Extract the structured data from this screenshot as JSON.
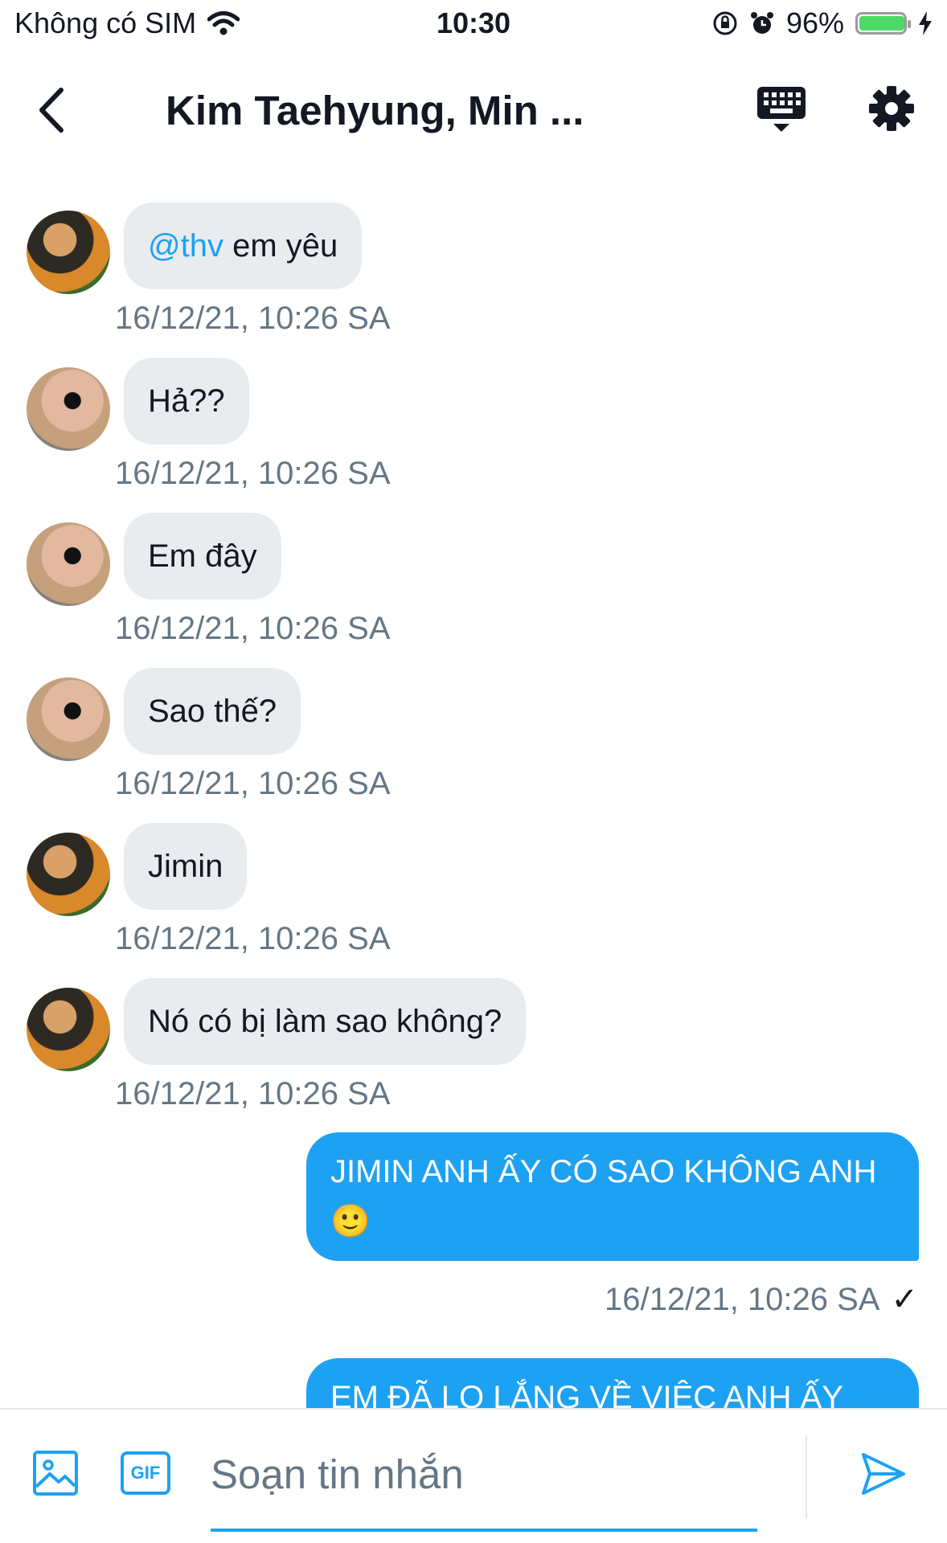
{
  "status_bar": {
    "carrier": "Không có SIM",
    "time": "10:30",
    "battery_percent": "96%",
    "battery_level": 0.96,
    "battery_color": "#4cd964"
  },
  "header": {
    "title": "Kim Taehyung, Min ...",
    "icons": [
      "chevron-left-icon",
      "keyboard-icon",
      "gear-icon"
    ]
  },
  "messages_in": [
    {
      "mention": "@thv",
      "text": " em yêu",
      "time": "16/12/21, 10:26 SA",
      "avatar": "avatar-1"
    },
    {
      "mention": "",
      "text": "Hả??",
      "time": "16/12/21, 10:26 SA",
      "avatar": "avatar-2"
    },
    {
      "mention": "",
      "text": "Em đây",
      "time": "16/12/21, 10:26 SA",
      "avatar": "avatar-2"
    },
    {
      "mention": "",
      "text": "Sao thế?",
      "time": "16/12/21, 10:26 SA",
      "avatar": "avatar-2"
    },
    {
      "mention": "",
      "text": "Jimin",
      "time": "16/12/21, 10:26 SA",
      "avatar": "avatar-1"
    },
    {
      "mention": "",
      "text": "Nó có bị làm sao không?",
      "time": "16/12/21, 10:26 SA",
      "avatar": "avatar-1"
    }
  ],
  "messages_out": [
    {
      "text": "JIMIN ANH ẤY CÓ SAO KHÔNG ANH 🙂",
      "time": "16/12/21, 10:26 SA",
      "status": "✓"
    },
    {
      "text": "EM ĐÃ LO LẮNG VỀ VIỆC ANH ẤY"
    }
  ],
  "composer": {
    "placeholder": "Soạn tin nhắn",
    "gif_label": "GIF"
  },
  "colors": {
    "accent": "#1da1f2",
    "incoming_bubble": "#e8ecef",
    "timestamp": "#657786"
  }
}
